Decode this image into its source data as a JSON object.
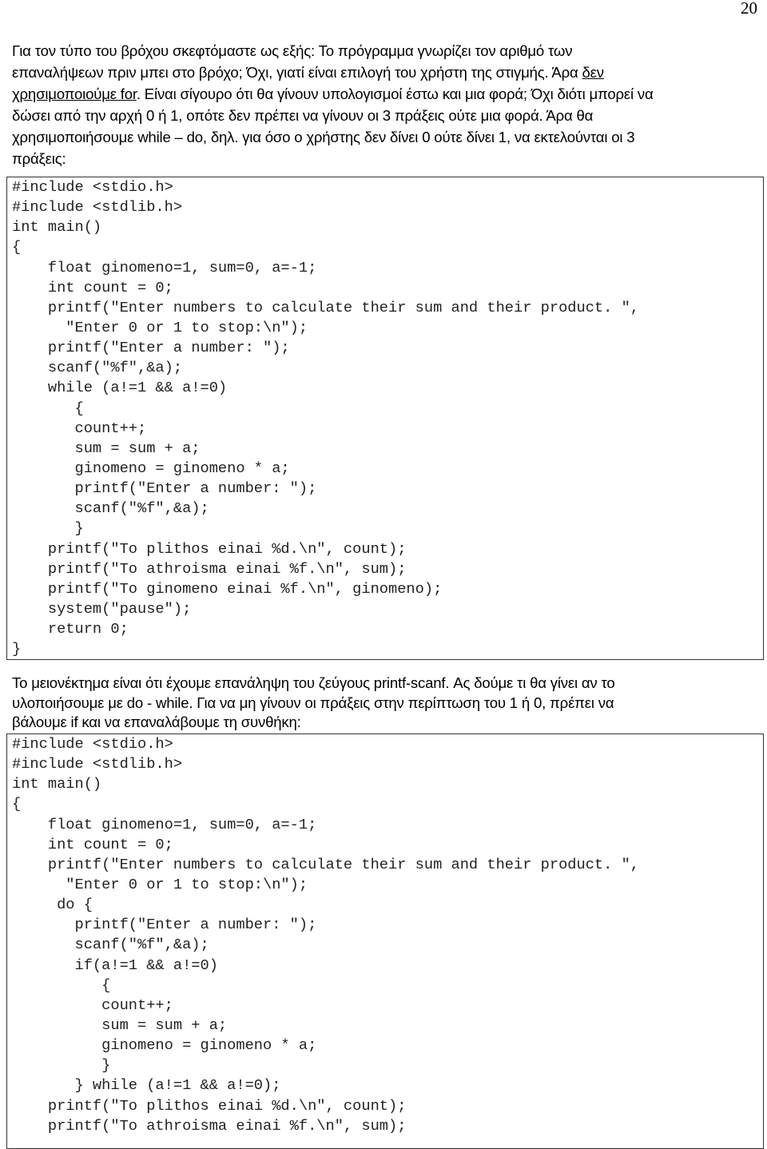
{
  "page_number": "20",
  "intro": {
    "l1": "Για τον τύπο του βρόχου σκεφτόμαστε ως εξής: Το πρόγραμμα γνωρίζει τον αριθμό των",
    "l2": "επαναλήψεων πριν μπει στο βρόχο; Όχι, γιατί είναι επιλογή του χρήστη της στιγμής. Άρα ",
    "l2_u": "δεν",
    "l3_u": "χρησιμοποιούμε for",
    "l3": ". Είναι σίγουρο ότι θα γίνουν υπολογισμοί έστω και μια φορά; Όχι διότι μπορεί να",
    "l4": "δώσει από την αρχή 0 ή 1, οπότε δεν πρέπει να γίνουν οι 3 πράξεις ούτε μια φορά. Άρα θα",
    "l5": "χρησιμοποιήσουμε while – do, δηλ. για όσο ο χρήστης δεν δίνει 0 ούτε δίνει 1, να εκτελούνται οι 3",
    "l6": "πράξεις:"
  },
  "code1": [
    "#include <stdio.h>",
    "#include <stdlib.h>",
    "int main()",
    "{",
    "    float ginomeno=1, sum=0, a=-1;",
    "    int count = 0;",
    "    printf(\"Enter numbers to calculate their sum and their product. \",",
    "      \"Enter 0 or 1 to stop:\\n\");",
    "    printf(\"Enter a number: \");",
    "    scanf(\"%f\",&a);",
    "    while (a!=1 && a!=0)",
    "       {",
    "       count++;",
    "       sum = sum + a;",
    "       ginomeno = ginomeno * a;",
    "       printf(\"Enter a number: \");",
    "       scanf(\"%f\",&a);",
    "       }",
    "    printf(\"To plithos einai %d.\\n\", count);",
    "    printf(\"To athroisma einai %f.\\n\", sum);",
    "    printf(\"To ginomeno einai %f.\\n\", ginomeno);",
    "    system(\"pause\");",
    "    return 0;",
    "}"
  ],
  "middle": {
    "l1": "Το μειονέκτημα είναι ότι έχουμε επανάληψη του ζεύγους printf-scanf. Ας δούμε τι θα γίνει αν το",
    "l2": "υλοποιήσουμε με do - while. Για να μη γίνουν οι πράξεις στην περίπτωση του 1 ή 0, πρέπει να",
    "l3": "βάλουμε if και να επαναλάβουμε τη συνθήκη:"
  },
  "code2": [
    "#include <stdio.h>",
    "#include <stdlib.h>",
    "int main()",
    "{",
    "    float ginomeno=1, sum=0, a=-1;",
    "    int count = 0;",
    "    printf(\"Enter numbers to calculate their sum and their product. \",",
    "      \"Enter 0 or 1 to stop:\\n\");",
    "     do {",
    "       printf(\"Enter a number: \");",
    "       scanf(\"%f\",&a);",
    "       if(a!=1 && a!=0)",
    "          {",
    "          count++;",
    "          sum = sum + a;",
    "          ginomeno = ginomeno * a;",
    "          }",
    "       } while (a!=1 && a!=0);",
    "    printf(\"To plithos einai %d.\\n\", count);",
    "    printf(\"To athroisma einai %f.\\n\", sum);"
  ]
}
